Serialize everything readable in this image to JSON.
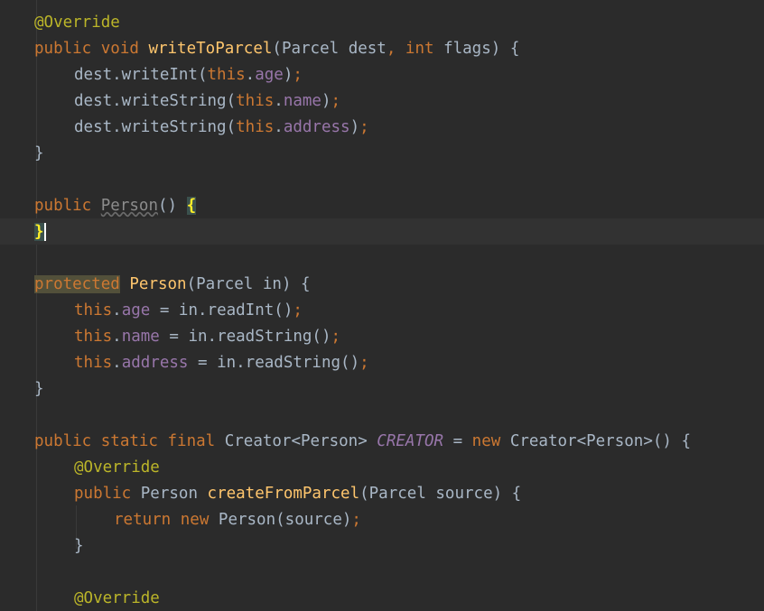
{
  "colors": {
    "background": "#2b2b2b",
    "current_line": "#323232",
    "default": "#a9b7c6",
    "keyword": "#cc7832",
    "annotation": "#bbb529",
    "method": "#ffc66d",
    "field": "#9876aa",
    "brace_match": "#ffef28"
  },
  "lines": [
    {
      "tokens": [
        {
          "t": "@Override",
          "c": "annotation"
        }
      ]
    },
    {
      "tokens": [
        {
          "t": "public void ",
          "c": "keyword"
        },
        {
          "t": "writeToParcel",
          "c": "method"
        },
        {
          "t": "(Parcel dest",
          "c": "default"
        },
        {
          "t": ", ",
          "c": "keyword"
        },
        {
          "t": "int ",
          "c": "keyword"
        },
        {
          "t": "flags) {",
          "c": "default"
        }
      ]
    },
    {
      "indent": 1,
      "tokens": [
        {
          "t": "dest.writeInt(",
          "c": "default"
        },
        {
          "t": "this",
          "c": "keyword"
        },
        {
          "t": ".",
          "c": "default"
        },
        {
          "t": "age",
          "c": "field"
        },
        {
          "t": ")",
          "c": "default"
        },
        {
          "t": ";",
          "c": "keyword"
        }
      ]
    },
    {
      "indent": 1,
      "tokens": [
        {
          "t": "dest.writeString(",
          "c": "default"
        },
        {
          "t": "this",
          "c": "keyword"
        },
        {
          "t": ".",
          "c": "default"
        },
        {
          "t": "name",
          "c": "field"
        },
        {
          "t": ")",
          "c": "default"
        },
        {
          "t": ";",
          "c": "keyword"
        }
      ]
    },
    {
      "indent": 1,
      "tokens": [
        {
          "t": "dest.writeString(",
          "c": "default"
        },
        {
          "t": "this",
          "c": "keyword"
        },
        {
          "t": ".",
          "c": "default"
        },
        {
          "t": "address",
          "c": "field"
        },
        {
          "t": ")",
          "c": "default"
        },
        {
          "t": ";",
          "c": "keyword"
        }
      ]
    },
    {
      "tokens": [
        {
          "t": "}",
          "c": "default"
        }
      ]
    },
    {
      "tokens": []
    },
    {
      "tokens": [
        {
          "t": "public ",
          "c": "keyword"
        },
        {
          "t": "Person",
          "c": "unused"
        },
        {
          "t": "() ",
          "c": "default"
        },
        {
          "t": "{",
          "c": "brace-match"
        }
      ]
    },
    {
      "current": true,
      "tokens": [
        {
          "t": "}",
          "c": "brace-match",
          "caret": true
        }
      ]
    },
    {
      "tokens": []
    },
    {
      "tokens": [
        {
          "t": "protected",
          "c": "keyword",
          "hl": true
        },
        {
          "t": " ",
          "c": "default"
        },
        {
          "t": "Person",
          "c": "method"
        },
        {
          "t": "(Parcel in) {",
          "c": "default"
        }
      ]
    },
    {
      "indent": 1,
      "tokens": [
        {
          "t": "this",
          "c": "keyword"
        },
        {
          "t": ".",
          "c": "default"
        },
        {
          "t": "age",
          "c": "field"
        },
        {
          "t": " = in.readInt()",
          "c": "default"
        },
        {
          "t": ";",
          "c": "keyword"
        }
      ]
    },
    {
      "indent": 1,
      "tokens": [
        {
          "t": "this",
          "c": "keyword"
        },
        {
          "t": ".",
          "c": "default"
        },
        {
          "t": "name",
          "c": "field"
        },
        {
          "t": " = in.readString()",
          "c": "default"
        },
        {
          "t": ";",
          "c": "keyword"
        }
      ]
    },
    {
      "indent": 1,
      "tokens": [
        {
          "t": "this",
          "c": "keyword"
        },
        {
          "t": ".",
          "c": "default"
        },
        {
          "t": "address",
          "c": "field"
        },
        {
          "t": " = in.readString()",
          "c": "default"
        },
        {
          "t": ";",
          "c": "keyword"
        }
      ]
    },
    {
      "tokens": [
        {
          "t": "}",
          "c": "default"
        }
      ]
    },
    {
      "tokens": []
    },
    {
      "tokens": [
        {
          "t": "public static final ",
          "c": "keyword"
        },
        {
          "t": "Creator<Person> ",
          "c": "default"
        },
        {
          "t": "CREATOR",
          "c": "static-field"
        },
        {
          "t": " = ",
          "c": "default"
        },
        {
          "t": "new ",
          "c": "keyword"
        },
        {
          "t": "Creator<Person>() {",
          "c": "default"
        }
      ]
    },
    {
      "indent": 1,
      "tokens": [
        {
          "t": "@Override",
          "c": "annotation"
        }
      ]
    },
    {
      "indent": 1,
      "tokens": [
        {
          "t": "public ",
          "c": "keyword"
        },
        {
          "t": "Person ",
          "c": "default"
        },
        {
          "t": "createFromParcel",
          "c": "method"
        },
        {
          "t": "(Parcel source) {",
          "c": "default"
        }
      ]
    },
    {
      "indent": 2,
      "tokens": [
        {
          "t": "return new ",
          "c": "keyword"
        },
        {
          "t": "Person(source)",
          "c": "default"
        },
        {
          "t": ";",
          "c": "keyword"
        }
      ]
    },
    {
      "indent": 1,
      "tokens": [
        {
          "t": "}",
          "c": "default"
        }
      ]
    },
    {
      "tokens": []
    },
    {
      "indent": 1,
      "tokens": [
        {
          "t": "@Override",
          "c": "annotation"
        }
      ]
    }
  ]
}
